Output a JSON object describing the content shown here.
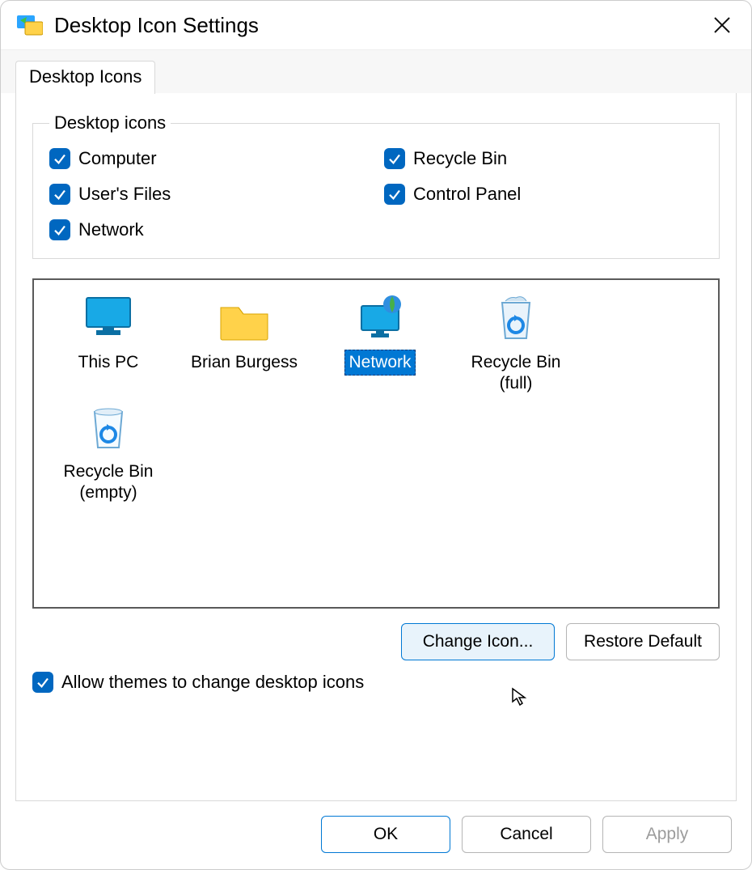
{
  "window": {
    "title": "Desktop Icon Settings"
  },
  "tabs": [
    {
      "label": "Desktop Icons"
    }
  ],
  "group": {
    "legend": "Desktop icons",
    "items": [
      {
        "label": "Computer",
        "checked": true
      },
      {
        "label": "Recycle Bin",
        "checked": true
      },
      {
        "label": "User's Files",
        "checked": true
      },
      {
        "label": "Control Panel",
        "checked": true
      },
      {
        "label": "Network",
        "checked": true
      }
    ]
  },
  "preview": {
    "items": [
      {
        "label": "This PC",
        "icon": "monitor",
        "selected": false
      },
      {
        "label": "Brian Burgess",
        "icon": "folder",
        "selected": false
      },
      {
        "label": "Network",
        "icon": "network",
        "selected": true
      },
      {
        "label": "Recycle Bin\n(full)",
        "icon": "recycle-full",
        "selected": false
      },
      {
        "label": "Recycle Bin\n(empty)",
        "icon": "recycle-empty",
        "selected": false
      }
    ]
  },
  "buttons": {
    "change_icon": "Change Icon...",
    "restore_default": "Restore Default",
    "ok": "OK",
    "cancel": "Cancel",
    "apply": "Apply"
  },
  "allow_themes": {
    "label": "Allow themes to change desktop icons",
    "checked": true
  }
}
